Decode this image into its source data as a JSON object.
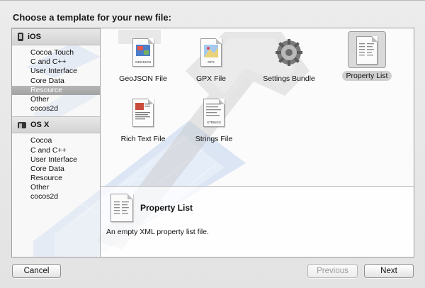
{
  "dialog": {
    "title": "Choose a template for your new file:"
  },
  "sidebar": {
    "platforms": [
      {
        "name": "iOS",
        "categories": [
          "Cocoa Touch",
          "C and C++",
          "User Interface",
          "Core Data",
          "Resource",
          "Other",
          "cocos2d"
        ],
        "selected_index": 4
      },
      {
        "name": "OS X",
        "categories": [
          "Cocoa",
          "C and C++",
          "User Interface",
          "Core Data",
          "Resource",
          "Other",
          "cocos2d"
        ]
      }
    ]
  },
  "templates": [
    {
      "label": "GeoJSON File",
      "icon_tag": "GEOJSON"
    },
    {
      "label": "GPX File",
      "icon_tag": "GPX"
    },
    {
      "label": "Settings Bundle",
      "icon": "gear-icon"
    },
    {
      "label": "Property List",
      "selected": true
    },
    {
      "label": "Rich Text File"
    },
    {
      "label": "Strings File",
      "icon_tag": "STRINGS"
    }
  ],
  "detail": {
    "name": "Property List",
    "description": "An empty XML property list file."
  },
  "buttons": {
    "cancel": "Cancel",
    "previous": "Previous",
    "next": "Next"
  }
}
